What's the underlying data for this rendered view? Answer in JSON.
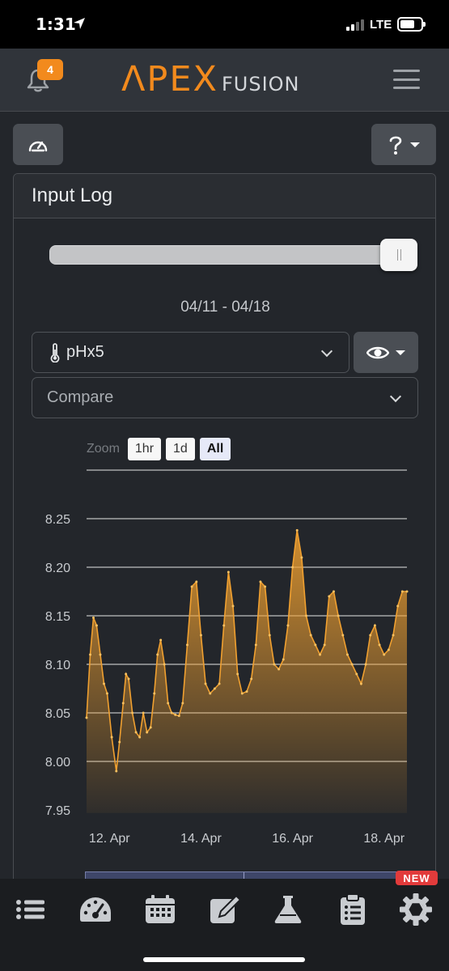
{
  "status_bar": {
    "time": "1:31",
    "network": "LTE",
    "battery_level": 0.7
  },
  "header": {
    "notification_count": "4",
    "logo_main": "ΛPEX",
    "logo_sub": "FUSION",
    "menu_icon": "hamburger-icon"
  },
  "toolbar": {
    "dashboard_icon": "gauge-icon",
    "help_icon": "question-icon"
  },
  "panel": {
    "title": "Input Log",
    "time_slider_position": 1.0,
    "date_range": "04/11 - 04/18",
    "probe_select": {
      "value": "pHx5",
      "icon": "thermometer-icon"
    },
    "visibility_icon": "eye-icon",
    "compare_select": {
      "placeholder": "Compare"
    },
    "zoom": {
      "label": "Zoom",
      "options": [
        "1hr",
        "1d",
        "All"
      ],
      "selected": "All"
    }
  },
  "chart_data": {
    "type": "area",
    "title": "",
    "xlabel": "",
    "ylabel": "",
    "x_ticks": [
      "12. Apr",
      "14. Apr",
      "16. Apr",
      "18. Apr"
    ],
    "y_ticks": [
      "7.95",
      "8.00",
      "8.05",
      "8.10",
      "8.15",
      "8.20",
      "8.25"
    ],
    "ylim": [
      7.95,
      8.3
    ],
    "xlim": [
      "04/11 12:00",
      "04/18 12:00"
    ],
    "grid": true,
    "color": "#f0a030",
    "series": [
      {
        "values_day_offset": [
          0.0,
          0.08,
          0.15,
          0.22,
          0.3,
          0.38,
          0.45,
          0.55,
          0.65,
          0.72,
          0.8,
          0.86,
          0.92,
          1.0,
          1.08,
          1.16,
          1.24,
          1.32,
          1.4,
          1.48,
          1.55,
          1.62,
          1.7,
          1.78,
          1.86,
          1.94,
          2.02,
          2.1,
          2.2,
          2.3,
          2.4,
          2.5,
          2.6,
          2.7,
          2.8,
          2.9,
          3.0,
          3.1,
          3.2,
          3.3,
          3.4,
          3.5,
          3.6,
          3.7,
          3.8,
          3.9,
          4.0,
          4.1,
          4.2,
          4.3,
          4.4,
          4.5,
          4.6,
          4.7,
          4.8,
          4.9,
          5.0,
          5.1,
          5.2,
          5.3,
          5.4,
          5.5,
          5.6,
          5.7,
          5.8,
          5.9,
          6.0,
          6.1,
          6.2,
          6.3,
          6.4,
          6.5,
          6.6,
          6.7,
          6.8,
          6.9,
          7.0
        ],
        "values": [
          8.045,
          8.11,
          8.148,
          8.14,
          8.11,
          8.08,
          8.07,
          8.025,
          7.99,
          8.02,
          8.06,
          8.09,
          8.085,
          8.05,
          8.03,
          8.025,
          8.05,
          8.03,
          8.035,
          8.07,
          8.11,
          8.125,
          8.1,
          8.06,
          8.05,
          8.048,
          8.047,
          8.06,
          8.12,
          8.18,
          8.185,
          8.13,
          8.08,
          8.07,
          8.075,
          8.08,
          8.14,
          8.195,
          8.16,
          8.09,
          8.07,
          8.072,
          8.085,
          8.12,
          8.185,
          8.18,
          8.13,
          8.1,
          8.095,
          8.105,
          8.14,
          8.2,
          8.238,
          8.21,
          8.15,
          8.13,
          8.12,
          8.11,
          8.12,
          8.17,
          8.175,
          8.15,
          8.13,
          8.11,
          8.1,
          8.09,
          8.08,
          8.1,
          8.13,
          8.14,
          8.12,
          8.11,
          8.115,
          8.13,
          8.16,
          8.175,
          8.175
        ]
      }
    ]
  },
  "bottom_nav": {
    "items": [
      "list-icon",
      "dashboard-gauge-icon",
      "calendar-icon",
      "note-edit-icon",
      "flask-icon",
      "clipboard-icon",
      "settings-gear-icon"
    ],
    "new_badge": "NEW"
  }
}
